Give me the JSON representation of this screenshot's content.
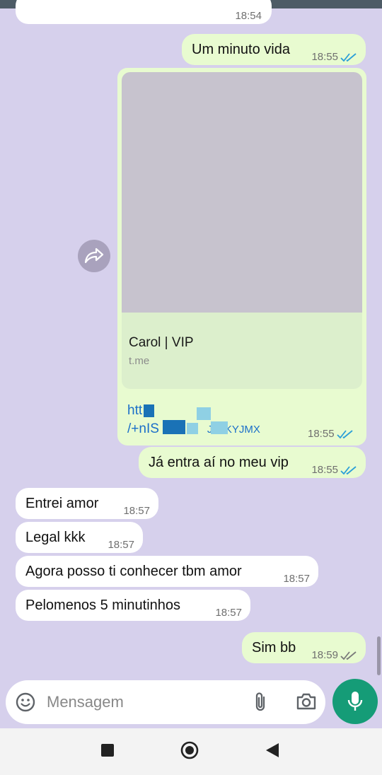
{
  "colors": {
    "chat_background": "#d6d0ec",
    "incoming_bubble": "#ffffff",
    "outgoing_bubble": "#e8fbd0",
    "read_ticks": "#2b9fd8",
    "delivered_ticks": "#7a7a7a",
    "link": "#1b6fc9",
    "send_button": "#159c77"
  },
  "messages": {
    "top_partial": {
      "time": "18:54"
    },
    "m1": {
      "text": "Um minuto vida",
      "time": "18:55",
      "status": "read"
    },
    "link_msg": {
      "preview_title": "Carol | VIP",
      "preview_domain": "t.me",
      "link_line1": "htt",
      "link_line2": "/+nIS",
      "link_tail": "JFuKYJMX",
      "time": "18:55",
      "status": "read"
    },
    "m3": {
      "text": "Já entra aí no meu vip",
      "time": "18:55",
      "status": "read"
    },
    "m4": {
      "text": "Entrei amor",
      "time": "18:57"
    },
    "m5": {
      "text": "Legal kkk",
      "time": "18:57"
    },
    "m6": {
      "text": "Agora posso ti conhecer tbm amor",
      "time": "18:57"
    },
    "m7": {
      "text": "Pelomenos 5 minutinhos",
      "time": "18:57"
    },
    "m8": {
      "text": "Sim bb",
      "time": "18:59",
      "status": "delivered"
    }
  },
  "composer": {
    "placeholder": "Mensagem",
    "icons": [
      "emoji-icon",
      "attach-icon",
      "camera-icon",
      "mic-icon"
    ]
  },
  "nav": {
    "icons": [
      "recents-square-icon",
      "home-circle-icon",
      "back-triangle-icon"
    ]
  }
}
